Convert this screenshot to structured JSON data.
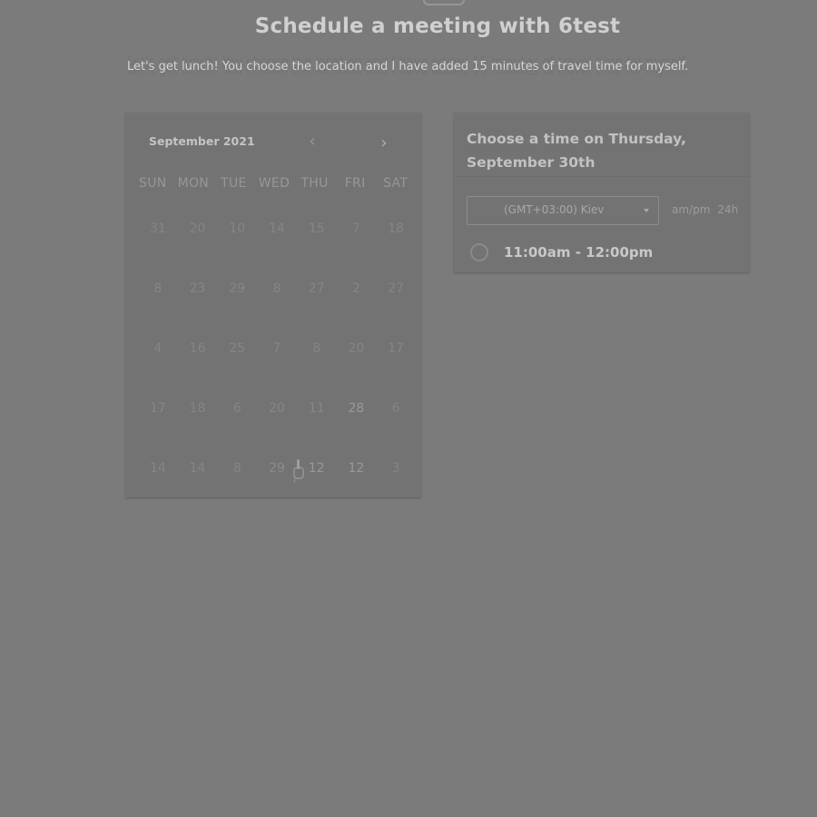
{
  "header": {
    "title": "Schedule a meeting with 6test",
    "subtitle": "Let's get lunch! You choose the location and I have added 15 minutes of travel time for myself."
  },
  "calendar": {
    "month_label": "September 2021",
    "prev_icon": "chevron-left-icon",
    "next_icon": "chevron-right-icon",
    "prev_glyph": "‹",
    "next_glyph": "›",
    "weekdays": [
      "SUN",
      "MON",
      "TUE",
      "WED",
      "THU",
      "FRI",
      "SAT"
    ],
    "weeks": [
      [
        "31",
        "20",
        "10",
        "14",
        "15",
        "7",
        "18"
      ],
      [
        "8",
        "23",
        "29",
        "8",
        "27",
        "2",
        "27"
      ],
      [
        "4",
        "16",
        "25",
        "7",
        "8",
        "20",
        "17"
      ],
      [
        "17",
        "18",
        "6",
        "20",
        "11",
        "28",
        "6"
      ],
      [
        "14",
        "14",
        "8",
        "29",
        "12",
        "12",
        "3"
      ]
    ]
  },
  "time_picker": {
    "title": "Choose a time on Thursday, September 30th",
    "timezone": "(GMT+03:00) Kiev",
    "format_options": [
      "am/pm",
      "24h"
    ],
    "slots": [
      {
        "label": "11:00am - 12:00pm"
      }
    ]
  }
}
